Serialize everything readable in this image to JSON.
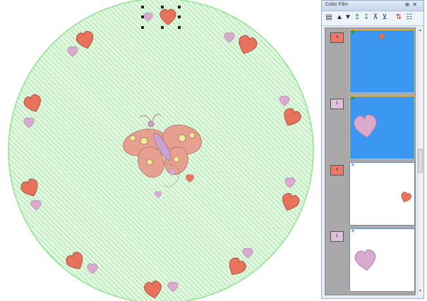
{
  "panel": {
    "title": "Color Film",
    "pin_glyph": "⊕",
    "close_glyph": "✕"
  },
  "toolbar": {
    "icons": [
      "film-options-icon",
      "move-up-icon",
      "move-down-icon",
      "move-to-top-icon",
      "move-to-bottom-icon",
      "move-first-icon",
      "move-last-icon",
      "sort-colors-icon",
      "panel-menu-icon"
    ]
  },
  "frames": [
    {
      "swatch_label": "4",
      "swatch_color": "#f0776a",
      "bg": "#3a98f2",
      "selected": true,
      "mark": "✱",
      "mark_color": "#2a9a2a"
    },
    {
      "swatch_label": "1",
      "swatch_color": "#dfc1dd",
      "bg": "#3a98f2",
      "selected": true,
      "mark": "✱",
      "mark_color": "#2a9a2a"
    },
    {
      "swatch_label": "4",
      "swatch_color": "#f0776a",
      "bg": "#ffffff",
      "selected": false,
      "mark": "✕",
      "mark_color": "#2a54c8"
    },
    {
      "swatch_label": "1",
      "swatch_color": "#dfc1dd",
      "bg": "#ffffff",
      "selected": false,
      "mark": "✕",
      "mark_color": "#2a54c8"
    }
  ],
  "colors": {
    "fill_hatch": "#8fe38f",
    "fill_bg": "#d9f5d9",
    "heart_coral": "#e8735c",
    "heart_pink": "#d9a9cf",
    "butterfly": "#e7a08f"
  }
}
